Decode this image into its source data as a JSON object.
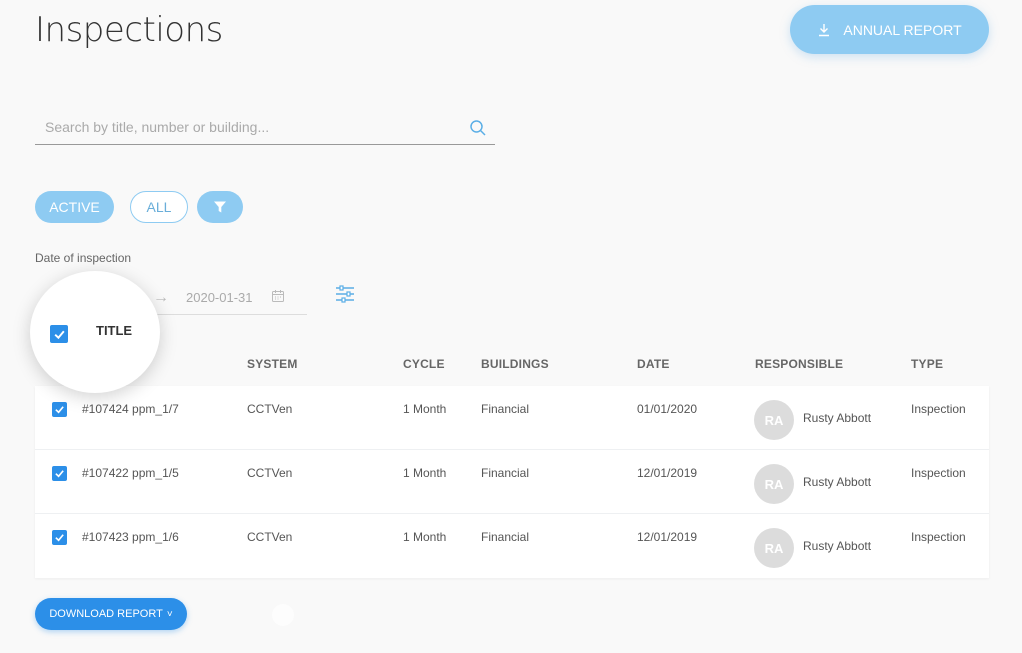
{
  "page": {
    "title": "Inspections"
  },
  "toolbar": {
    "annual_report_label": "ANNUAL REPORT"
  },
  "search": {
    "placeholder": "Search by title, number or building...",
    "value": ""
  },
  "filters": {
    "active_label": "ACTIVE",
    "all_label": "ALL",
    "selected": "ACTIVE"
  },
  "date_filter": {
    "label": "Date of inspection",
    "start": "",
    "end": "2020-01-31",
    "arrow": "→"
  },
  "table": {
    "headers": {
      "title": "TITLE",
      "system": "SYSTEM",
      "cycle": "CYCLE",
      "buildings": "BUILDINGS",
      "date": "DATE",
      "responsible": "RESPONSIBLE",
      "type": "TYPE"
    },
    "rows": [
      {
        "checked": true,
        "title": "#107424 ppm_1/7",
        "system": "CCTVen",
        "cycle": "1 Month",
        "buildings": "Financial",
        "date": "01/01/2020",
        "initials": "RA",
        "responsible": "Rusty Abbott",
        "type": "Inspection"
      },
      {
        "checked": true,
        "title": "#107422 ppm_1/5",
        "system": "CCTVen",
        "cycle": "1 Month",
        "buildings": "Financial",
        "date": "12/01/2019",
        "initials": "RA",
        "responsible": "Rusty Abbott",
        "type": "Inspection"
      },
      {
        "checked": true,
        "title": "#107423 ppm_1/6",
        "system": "CCTVen",
        "cycle": "1 Month",
        "buildings": "Financial",
        "date": "12/01/2019",
        "initials": "RA",
        "responsible": "Rusty Abbott",
        "type": "Inspection"
      }
    ]
  },
  "footer": {
    "download_report_label": "DOWNLOAD REPORT",
    "caret": "˅"
  },
  "colors": {
    "accent_light": "#8ecbf2",
    "accent": "#2c8fe8",
    "avatar_bg": "#dcdcdc"
  },
  "icons": [
    "download-icon",
    "search-icon",
    "filter-icon",
    "calendar-icon",
    "adjust-icon",
    "check-icon"
  ]
}
